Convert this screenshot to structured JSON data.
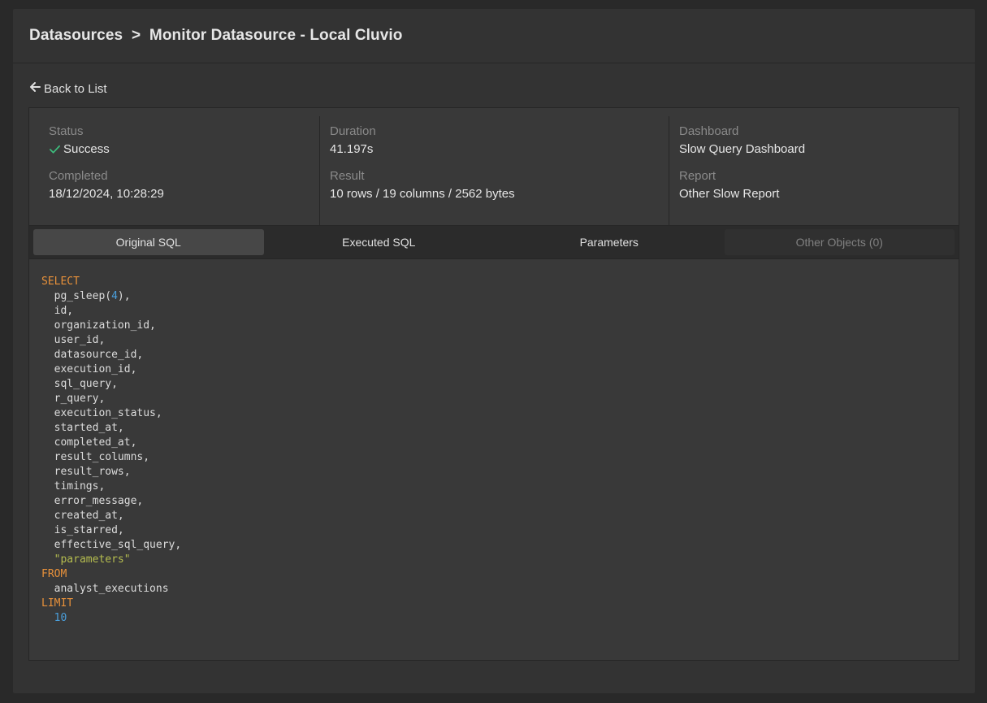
{
  "header": {
    "breadcrumb": [
      {
        "label": "Datasources"
      },
      {
        "label": ">"
      },
      {
        "label": "Monitor Datasource - Local Cluvio"
      }
    ]
  },
  "back_link": {
    "label": "Back to List",
    "icon": "arrow-left-icon"
  },
  "meta": {
    "status": {
      "label": "Status",
      "value": "Success",
      "icon": "check-icon",
      "icon_color": "#3dbd7d"
    },
    "completed": {
      "label": "Completed",
      "value": "18/12/2024, 10:28:29"
    },
    "duration": {
      "label": "Duration",
      "value": "41.197s"
    },
    "result": {
      "label": "Result",
      "value": "10 rows / 19 columns / 2562 bytes"
    },
    "dashboard": {
      "label": "Dashboard",
      "value": "Slow Query Dashboard"
    },
    "report": {
      "label": "Report",
      "value": "Other Slow Report"
    }
  },
  "tabs": [
    {
      "label": "Original SQL",
      "state": "active"
    },
    {
      "label": "Executed SQL",
      "state": "normal"
    },
    {
      "label": "Parameters",
      "state": "normal"
    },
    {
      "label": "Other Objects (0)",
      "state": "disabled"
    }
  ],
  "sql": {
    "lines": [
      [
        {
          "t": "SELECT",
          "c": "kw"
        }
      ],
      [
        {
          "t": "  pg_sleep("
        },
        {
          "t": "4",
          "c": "num"
        },
        {
          "t": "),"
        }
      ],
      [
        {
          "t": "  id,"
        }
      ],
      [
        {
          "t": "  organization_id,"
        }
      ],
      [
        {
          "t": "  user_id,"
        }
      ],
      [
        {
          "t": "  datasource_id,"
        }
      ],
      [
        {
          "t": "  execution_id,"
        }
      ],
      [
        {
          "t": "  sql_query,"
        }
      ],
      [
        {
          "t": "  r_query,"
        }
      ],
      [
        {
          "t": "  execution_status,"
        }
      ],
      [
        {
          "t": "  started_at,"
        }
      ],
      [
        {
          "t": "  completed_at,"
        }
      ],
      [
        {
          "t": "  result_columns,"
        }
      ],
      [
        {
          "t": "  result_rows,"
        }
      ],
      [
        {
          "t": "  timings,"
        }
      ],
      [
        {
          "t": "  error_message,"
        }
      ],
      [
        {
          "t": "  created_at,"
        }
      ],
      [
        {
          "t": "  is_starred,"
        }
      ],
      [
        {
          "t": "  effective_sql_query,"
        }
      ],
      [
        {
          "t": "  "
        },
        {
          "t": "\"parameters\"",
          "c": "str"
        }
      ],
      [
        {
          "t": "FROM",
          "c": "kw"
        }
      ],
      [
        {
          "t": "  analyst_executions"
        }
      ],
      [
        {
          "t": "LIMIT",
          "c": "kw"
        }
      ],
      [
        {
          "t": "  "
        },
        {
          "t": "10",
          "c": "num"
        }
      ]
    ]
  },
  "colors": {
    "keyword": "#e8913a",
    "number": "#4a9fdc",
    "string": "#b5bd4f",
    "success": "#3dbd7d"
  }
}
